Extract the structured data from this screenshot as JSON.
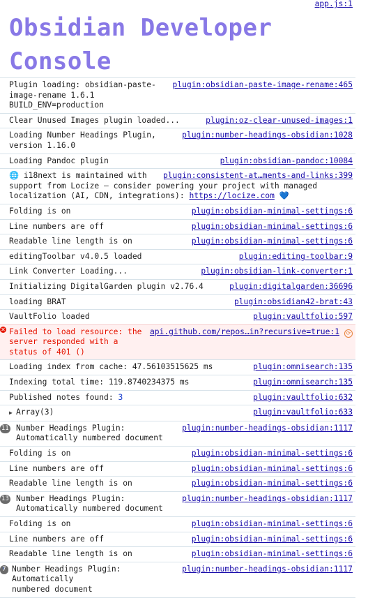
{
  "header": {
    "top_source": "app.js:1",
    "title": "Obsidian Developer Console"
  },
  "rows": {
    "r1": {
      "msg": "Plugin loading: obsidian-paste-\nimage-rename 1.6.1 BUILD_ENV=production",
      "src": "plugin:obsidian-paste-image-rename:465"
    },
    "r2": {
      "msg": "Clear Unused Images plugin loaded...",
      "src": "plugin:oz-clear-unused-images:1"
    },
    "r3": {
      "msg": "Loading Number Headings Plugin,\nversion 1.16.0",
      "src": "plugin:number-headings-obsidian:1028"
    },
    "r4": {
      "msg": "Loading Pandoc plugin",
      "src": "plugin:obsidian-pandoc:10084"
    },
    "r5": {
      "globe": "🌐",
      "msg_a": " i18next is maintained with",
      "msg_b": "support from Locize — consider powering your project with managed\nlocalization (AI, CDN, integrations): ",
      "link": "https://locize.com",
      "heart": "💙",
      "src": "plugin:consistent-at…ments-and-links:399"
    },
    "r6": {
      "msg": "Folding is on",
      "src": "plugin:obsidian-minimal-settings:6"
    },
    "r7": {
      "msg": "Line numbers are off",
      "src": "plugin:obsidian-minimal-settings:6"
    },
    "r8": {
      "msg": "Readable line length is on",
      "src": "plugin:obsidian-minimal-settings:6"
    },
    "r9": {
      "msg": "editingToolbar v4.0.5 loaded",
      "src": "plugin:editing-toolbar:9"
    },
    "r10": {
      "msg": "Link Converter Loading...",
      "src": "plugin:obsidian-link-converter:1"
    },
    "r11": {
      "msg": "Initializing DigitalGarden plugin v2.76.4",
      "src": "plugin:digitalgarden:36696"
    },
    "r12": {
      "msg": "loading BRAT",
      "src": "plugin:obsidian42-brat:43"
    },
    "r13": {
      "msg": "VaultFolio loaded",
      "src": "plugin:vaultfolio:597"
    },
    "r14": {
      "msg": "Failed to load resource: the\nserver responded with a status of 401 ()",
      "src": "api.github.com/repos…in?recursive=true:1",
      "icon": "✕",
      "ext_icon": "⟳"
    },
    "r15": {
      "msg": "Loading index from cache: 47.56103515625 ms",
      "src": "plugin:omnisearch:135"
    },
    "r16": {
      "msg": "Indexing total time: 119.8740234375 ms",
      "src": "plugin:omnisearch:135"
    },
    "r17": {
      "msg": "Published notes found: ",
      "num": "3",
      "src": "plugin:vaultfolio:632"
    },
    "r18": {
      "caret": "▶",
      "msg": "Array(3)",
      "src": "plugin:vaultfolio:633"
    },
    "r19": {
      "count": "11",
      "msg": "Number Headings Plugin:\nAutomatically numbered document",
      "src": "plugin:number-headings-obsidian:1117"
    },
    "r20": {
      "msg": "Folding is on",
      "src": "plugin:obsidian-minimal-settings:6"
    },
    "r21": {
      "msg": "Line numbers are off",
      "src": "plugin:obsidian-minimal-settings:6"
    },
    "r22": {
      "msg": "Readable line length is on",
      "src": "plugin:obsidian-minimal-settings:6"
    },
    "r23": {
      "count": "13",
      "msg": "Number Headings Plugin:\nAutomatically numbered document",
      "src": "plugin:number-headings-obsidian:1117"
    },
    "r24": {
      "msg": "Folding is on",
      "src": "plugin:obsidian-minimal-settings:6"
    },
    "r25": {
      "msg": "Line numbers are off",
      "src": "plugin:obsidian-minimal-settings:6"
    },
    "r26": {
      "msg": "Readable line length is on",
      "src": "plugin:obsidian-minimal-settings:6"
    },
    "r27": {
      "count": "7",
      "msg": "Number Headings Plugin: Automatically\nnumbered document",
      "src": "plugin:number-headings-obsidian:1117"
    }
  },
  "prompt": {
    "caret": "›"
  },
  "colors": {
    "title": "#8878e6",
    "link": "#1a0dab",
    "error": "#e51400",
    "error_bg": "#fff0f0",
    "badge": "#6b6b6b",
    "number": "#1a3fd0"
  }
}
